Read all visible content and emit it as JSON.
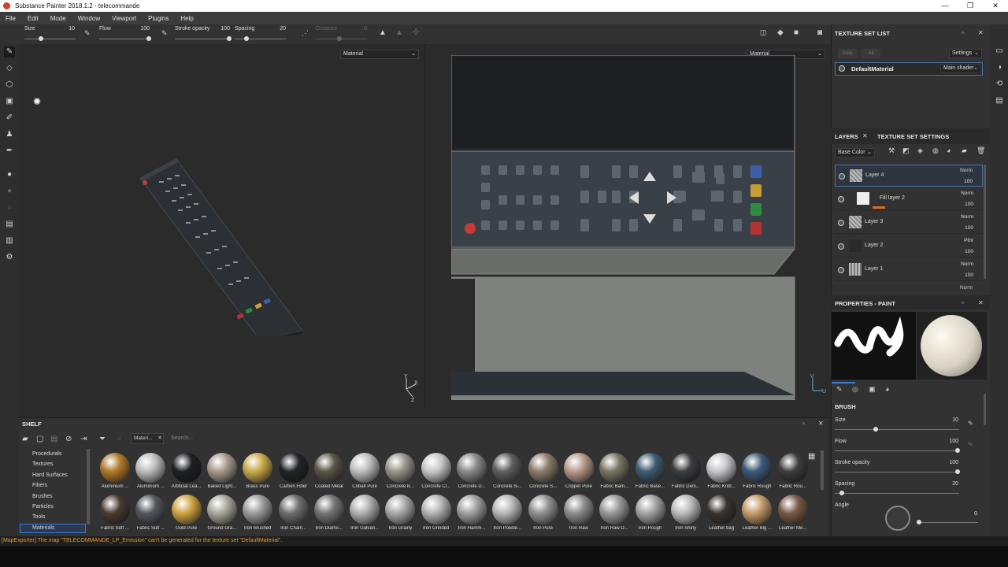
{
  "window": {
    "title": "Substance Painter 2018.1.2 - telecommande",
    "controls": [
      "—",
      "❐",
      "✕"
    ]
  },
  "menu": [
    "File",
    "Edit",
    "Mode",
    "Window",
    "Viewport",
    "Plugins",
    "Help"
  ],
  "toolbar": {
    "size_label": "Size",
    "size_value": "10",
    "flow_label": "Flow",
    "flow_value": "100",
    "opacity_label": "Stroke opacity",
    "opacity_value": "100",
    "spacing_label": "Spacing",
    "spacing_value": "20",
    "distance_label": "Distance",
    "distance_value": "0"
  },
  "viewport3d": {
    "channel": "Material"
  },
  "viewport2d": {
    "channel": "Material"
  },
  "texture_set_list": {
    "title": "TEXTURE SET LIST",
    "solo": "Solo",
    "all": "All",
    "settings": "Settings",
    "material": "DefaultMaterial",
    "shader": "Main shader"
  },
  "layers_panel": {
    "tab_layers": "LAYERS",
    "tab_settings": "TEXTURE SET SETTINGS",
    "channel": "Base Color",
    "layers": [
      {
        "name": "Layer 4",
        "blend": "Norm",
        "opacity": "100"
      },
      {
        "name": "Fill layer 2",
        "blend": "Norm",
        "opacity": "100"
      },
      {
        "name": "Layer 3",
        "blend": "Norm",
        "opacity": "100"
      },
      {
        "name": "Layer 2",
        "blend": "Pthr",
        "opacity": "100"
      },
      {
        "name": "Layer 1",
        "blend": "Norm",
        "opacity": "100"
      }
    ],
    "partial_blend": "Norm"
  },
  "properties": {
    "title": "PROPERTIES - PAINT",
    "section": "BRUSH",
    "size_label": "Size",
    "size_value": "10",
    "flow_label": "Flow",
    "flow_value": "100",
    "opacity_label": "Stroke opacity",
    "opacity_value": "100",
    "spacing_label": "Spacing",
    "spacing_value": "20",
    "angle_label": "Angle",
    "angle_value": "0"
  },
  "shelf": {
    "title": "SHELF",
    "filter_tag": "Materi...",
    "search_placeholder": "Search...",
    "categories": [
      "Procedurals",
      "Textures",
      "Hard Surfaces",
      "Filters",
      "Brushes",
      "Particles",
      "Tools",
      "Materials"
    ],
    "selected_category": "Materials",
    "materials_row1": [
      "Aluminium ...",
      "Aluminium ...",
      "Artificial Lea...",
      "Baked Light...",
      "Brass Pure",
      "Carbon Fiber",
      "Coated Metal",
      "Cobalt Pure",
      "Concrete B...",
      "Concrete Cl...",
      "Concrete D...",
      "Concrete Si...",
      "Concrete S...",
      "Copper Pure",
      "Fabric Bam...",
      "Fabric Base...",
      "Fabric Deni...",
      "Fabric Knitt...",
      "Fabric Rough",
      "Fabric Rou..."
    ],
    "materials_row2": [
      "Fabric Soft ...",
      "Fabric Suit ...",
      "Gold Pure",
      "Ground Gra...",
      "Iron Brushed",
      "Iron Chain...",
      "Iron Diamo...",
      "Iron Galvan...",
      "Iron Grainy",
      "Iron Grinded",
      "Iron Hamm...",
      "Iron Powde...",
      "Iron Pure",
      "Iron Raw",
      "Iron Raw D...",
      "Iron Rough",
      "Iron Shiny",
      "Leather bag",
      "Leather Big ...",
      "Leather Me..."
    ],
    "colors_row1": [
      "#b07a2a",
      "#bdbdbd",
      "#1d1f22",
      "#a89b8c",
      "#c9a94a",
      "#222326",
      "#5b5648",
      "#bfbfbf",
      "#9a968e",
      "#c7c7c7",
      "#8a8a8a",
      "#5f5f5f",
      "#8b7d6c",
      "#b79a8a",
      "#7a7565",
      "#3f5c70",
      "#3b3c40",
      "#c8c6cc",
      "#3e5a78",
      "#3d3d3d"
    ],
    "colors_row2": [
      "#4a3a30",
      "#55585e",
      "#d0a443",
      "#a9a89c",
      "#9c9c9c",
      "#6e6e6e",
      "#757575",
      "#b0b0b0",
      "#a9a9a9",
      "#b5b5b5",
      "#a0a0a0",
      "#b8b8b8",
      "#909090",
      "#8d8d8d",
      "#999999",
      "#a4a4a4",
      "#bcbcbc",
      "#3a3431",
      "#c59c6a",
      "#7a5a46"
    ]
  },
  "status": {
    "message": "[MapExporter] The map \"TELECOMMANDE_LP_Emission\" can't be generated for the texture set \"DefaultMaterial\"."
  },
  "colors": {
    "accent_blue": "#3a7bd5",
    "status_orange": "#e69a2e"
  }
}
